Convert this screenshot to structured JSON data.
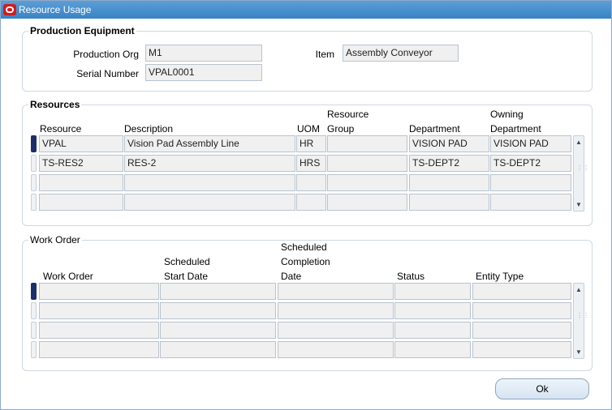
{
  "window": {
    "title": "Resource Usage"
  },
  "production_equipment": {
    "heading": "Production Equipment",
    "production_org_label": "Production Org",
    "production_org_value": "M1",
    "serial_number_label": "Serial Number",
    "serial_number_value": "VPAL0001",
    "item_label": "Item",
    "item_value": "Assembly Conveyor"
  },
  "resources": {
    "heading": "Resources",
    "columns": {
      "resource": "Resource",
      "description": "Description",
      "uom": "UOM",
      "resource_group_1": "Resource",
      "resource_group_2": "Group",
      "department": "Department",
      "owning_department_1": "Owning",
      "owning_department_2": "Department"
    },
    "rows": [
      {
        "resource": "VPAL",
        "description": "Vision Pad Assembly Line",
        "uom": "HR",
        "group": "",
        "department": "VISION PAD",
        "owning_department": "VISION PAD"
      },
      {
        "resource": "TS-RES2",
        "description": "RES-2",
        "uom": "HRS",
        "group": "",
        "department": "TS-DEPT2",
        "owning_department": "TS-DEPT2"
      },
      {
        "resource": "",
        "description": "",
        "uom": "",
        "group": "",
        "department": "",
        "owning_department": ""
      },
      {
        "resource": "",
        "description": "",
        "uom": "",
        "group": "",
        "department": "",
        "owning_department": ""
      }
    ]
  },
  "work_order": {
    "heading": "Work Order",
    "columns": {
      "work_order": "Work Order",
      "scheduled_start_1": "Scheduled",
      "scheduled_start_2": "Start Date",
      "scheduled_completion_1": "Scheduled",
      "scheduled_completion_2": "Completion",
      "scheduled_completion_3": "Date",
      "status": "Status",
      "entity_type": "Entity Type"
    },
    "rows": [
      {
        "work_order": "",
        "start": "",
        "completion": "",
        "status": "",
        "entity_type": ""
      },
      {
        "work_order": "",
        "start": "",
        "completion": "",
        "status": "",
        "entity_type": ""
      },
      {
        "work_order": "",
        "start": "",
        "completion": "",
        "status": "",
        "entity_type": ""
      },
      {
        "work_order": "",
        "start": "",
        "completion": "",
        "status": "",
        "entity_type": ""
      }
    ]
  },
  "buttons": {
    "ok": "Ok"
  },
  "icons": {
    "title": "oracle-logo-icon",
    "scroll_up": "arrow-up-icon",
    "scroll_down": "arrow-down-icon"
  },
  "colors": {
    "titlebar": "#3a82c4",
    "active_row_indicator": "#1d2f6b"
  }
}
